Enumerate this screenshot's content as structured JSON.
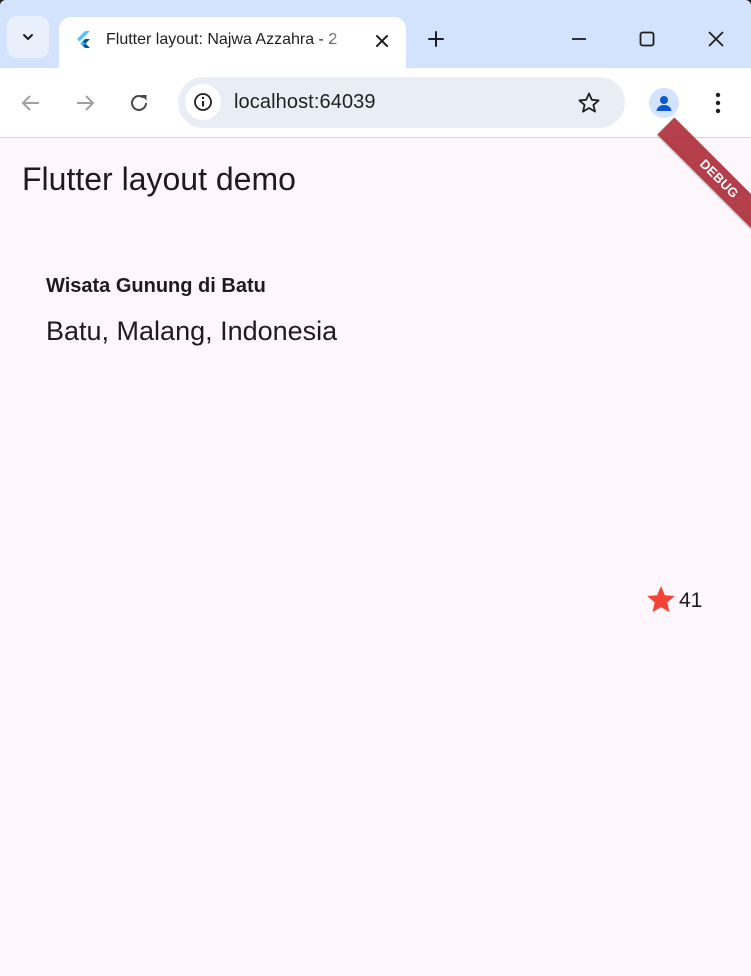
{
  "browser": {
    "tab_title": "Flutter layout: Najwa Azzahra - 2",
    "url": "localhost:64039"
  },
  "app": {
    "title": "Flutter layout demo",
    "debug_banner": "DEBUG",
    "place_name": "Wisata Gunung di Batu",
    "location": "Batu, Malang, Indonesia",
    "rating_count": "41"
  },
  "colors": {
    "tabstrip": "#d3e3fd",
    "page_background": "#fdf6fc",
    "star": "#f44336",
    "banner": "#a8202d"
  },
  "icons": {
    "tab_search": "chevron-down-icon",
    "favicon": "flutter-icon",
    "tab_close": "close-icon",
    "new_tab": "plus-icon",
    "minimize": "minimize-icon",
    "maximize": "maximize-icon",
    "close_window": "close-icon",
    "back": "arrow-left-icon",
    "forward": "arrow-right-icon",
    "reload": "reload-icon",
    "site_info": "info-icon",
    "bookmark": "star-outline-icon",
    "profile": "person-icon",
    "menu": "kebab-menu-icon",
    "rating": "star-icon"
  }
}
